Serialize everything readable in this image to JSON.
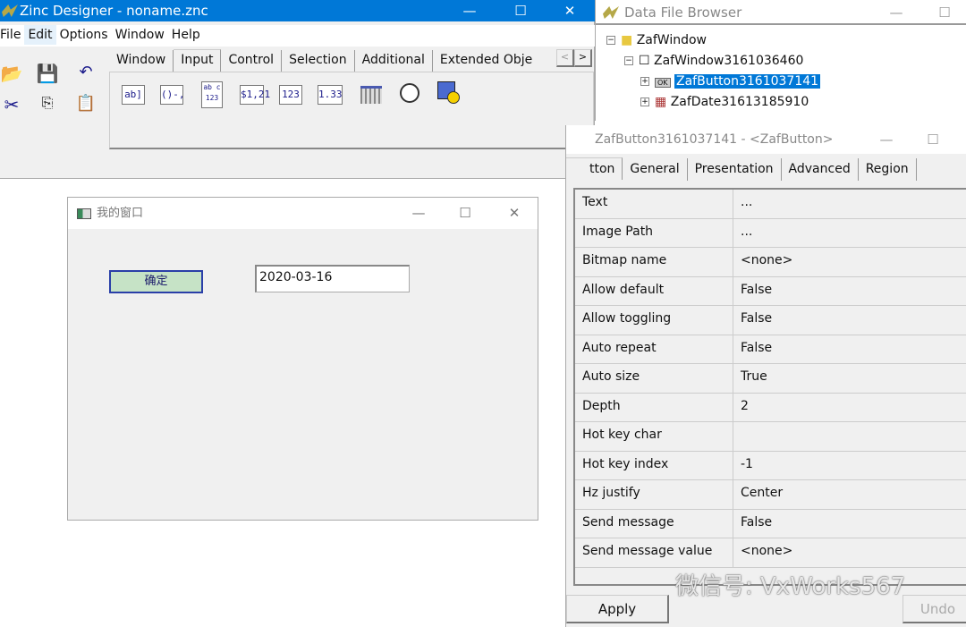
{
  "main_window": {
    "title": "Zinc Designer - noname.znc",
    "menu": [
      "File",
      "Edit",
      "Options",
      "Window",
      "Help"
    ],
    "tabs": [
      "Window",
      "Input",
      "Control",
      "Selection",
      "Additional",
      "Extended Obje"
    ],
    "selected_tab": "Input",
    "palette": [
      "ab]",
      "()-,",
      "ab c 123",
      "$1,21",
      "123",
      "1.33"
    ]
  },
  "data_file_browser": {
    "title": "Data File Browser",
    "tree": [
      {
        "label": "ZafWindow",
        "level": 0
      },
      {
        "label": "ZafWindow3161036460",
        "level": 1
      },
      {
        "label": "ZafButton3161037141",
        "level": 2,
        "selected": true
      },
      {
        "label": "ZafDate31613185910",
        "level": 2
      }
    ]
  },
  "properties": {
    "title": "ZafButton3161037141 - <ZafButton>",
    "tabs": [
      "tton",
      "General",
      "Presentation",
      "Advanced",
      "Region"
    ],
    "rows": [
      [
        "Text",
        "..."
      ],
      [
        "Image Path",
        "..."
      ],
      [
        "Bitmap name",
        "<none>"
      ],
      [
        "Allow default",
        "False"
      ],
      [
        "Allow toggling",
        "False"
      ],
      [
        "Auto repeat",
        "False"
      ],
      [
        "Auto size",
        "True"
      ],
      [
        "Depth",
        "2"
      ],
      [
        "Hot key char",
        ""
      ],
      [
        "Hot key index",
        "-1"
      ],
      [
        "Hz justify",
        "Center"
      ],
      [
        "Send message",
        "False"
      ],
      [
        "Send message value",
        "<none>"
      ]
    ],
    "apply": "Apply",
    "undo": "Undo"
  },
  "dialog": {
    "title": "我的窗口",
    "button": "确定",
    "date_value": "2020-03-16"
  },
  "watermark": "微信号: VxWorks567",
  "colors": {
    "titlebar": "#0078d7",
    "selection": "#0078d7",
    "button_fill": "#c6e3c6"
  }
}
